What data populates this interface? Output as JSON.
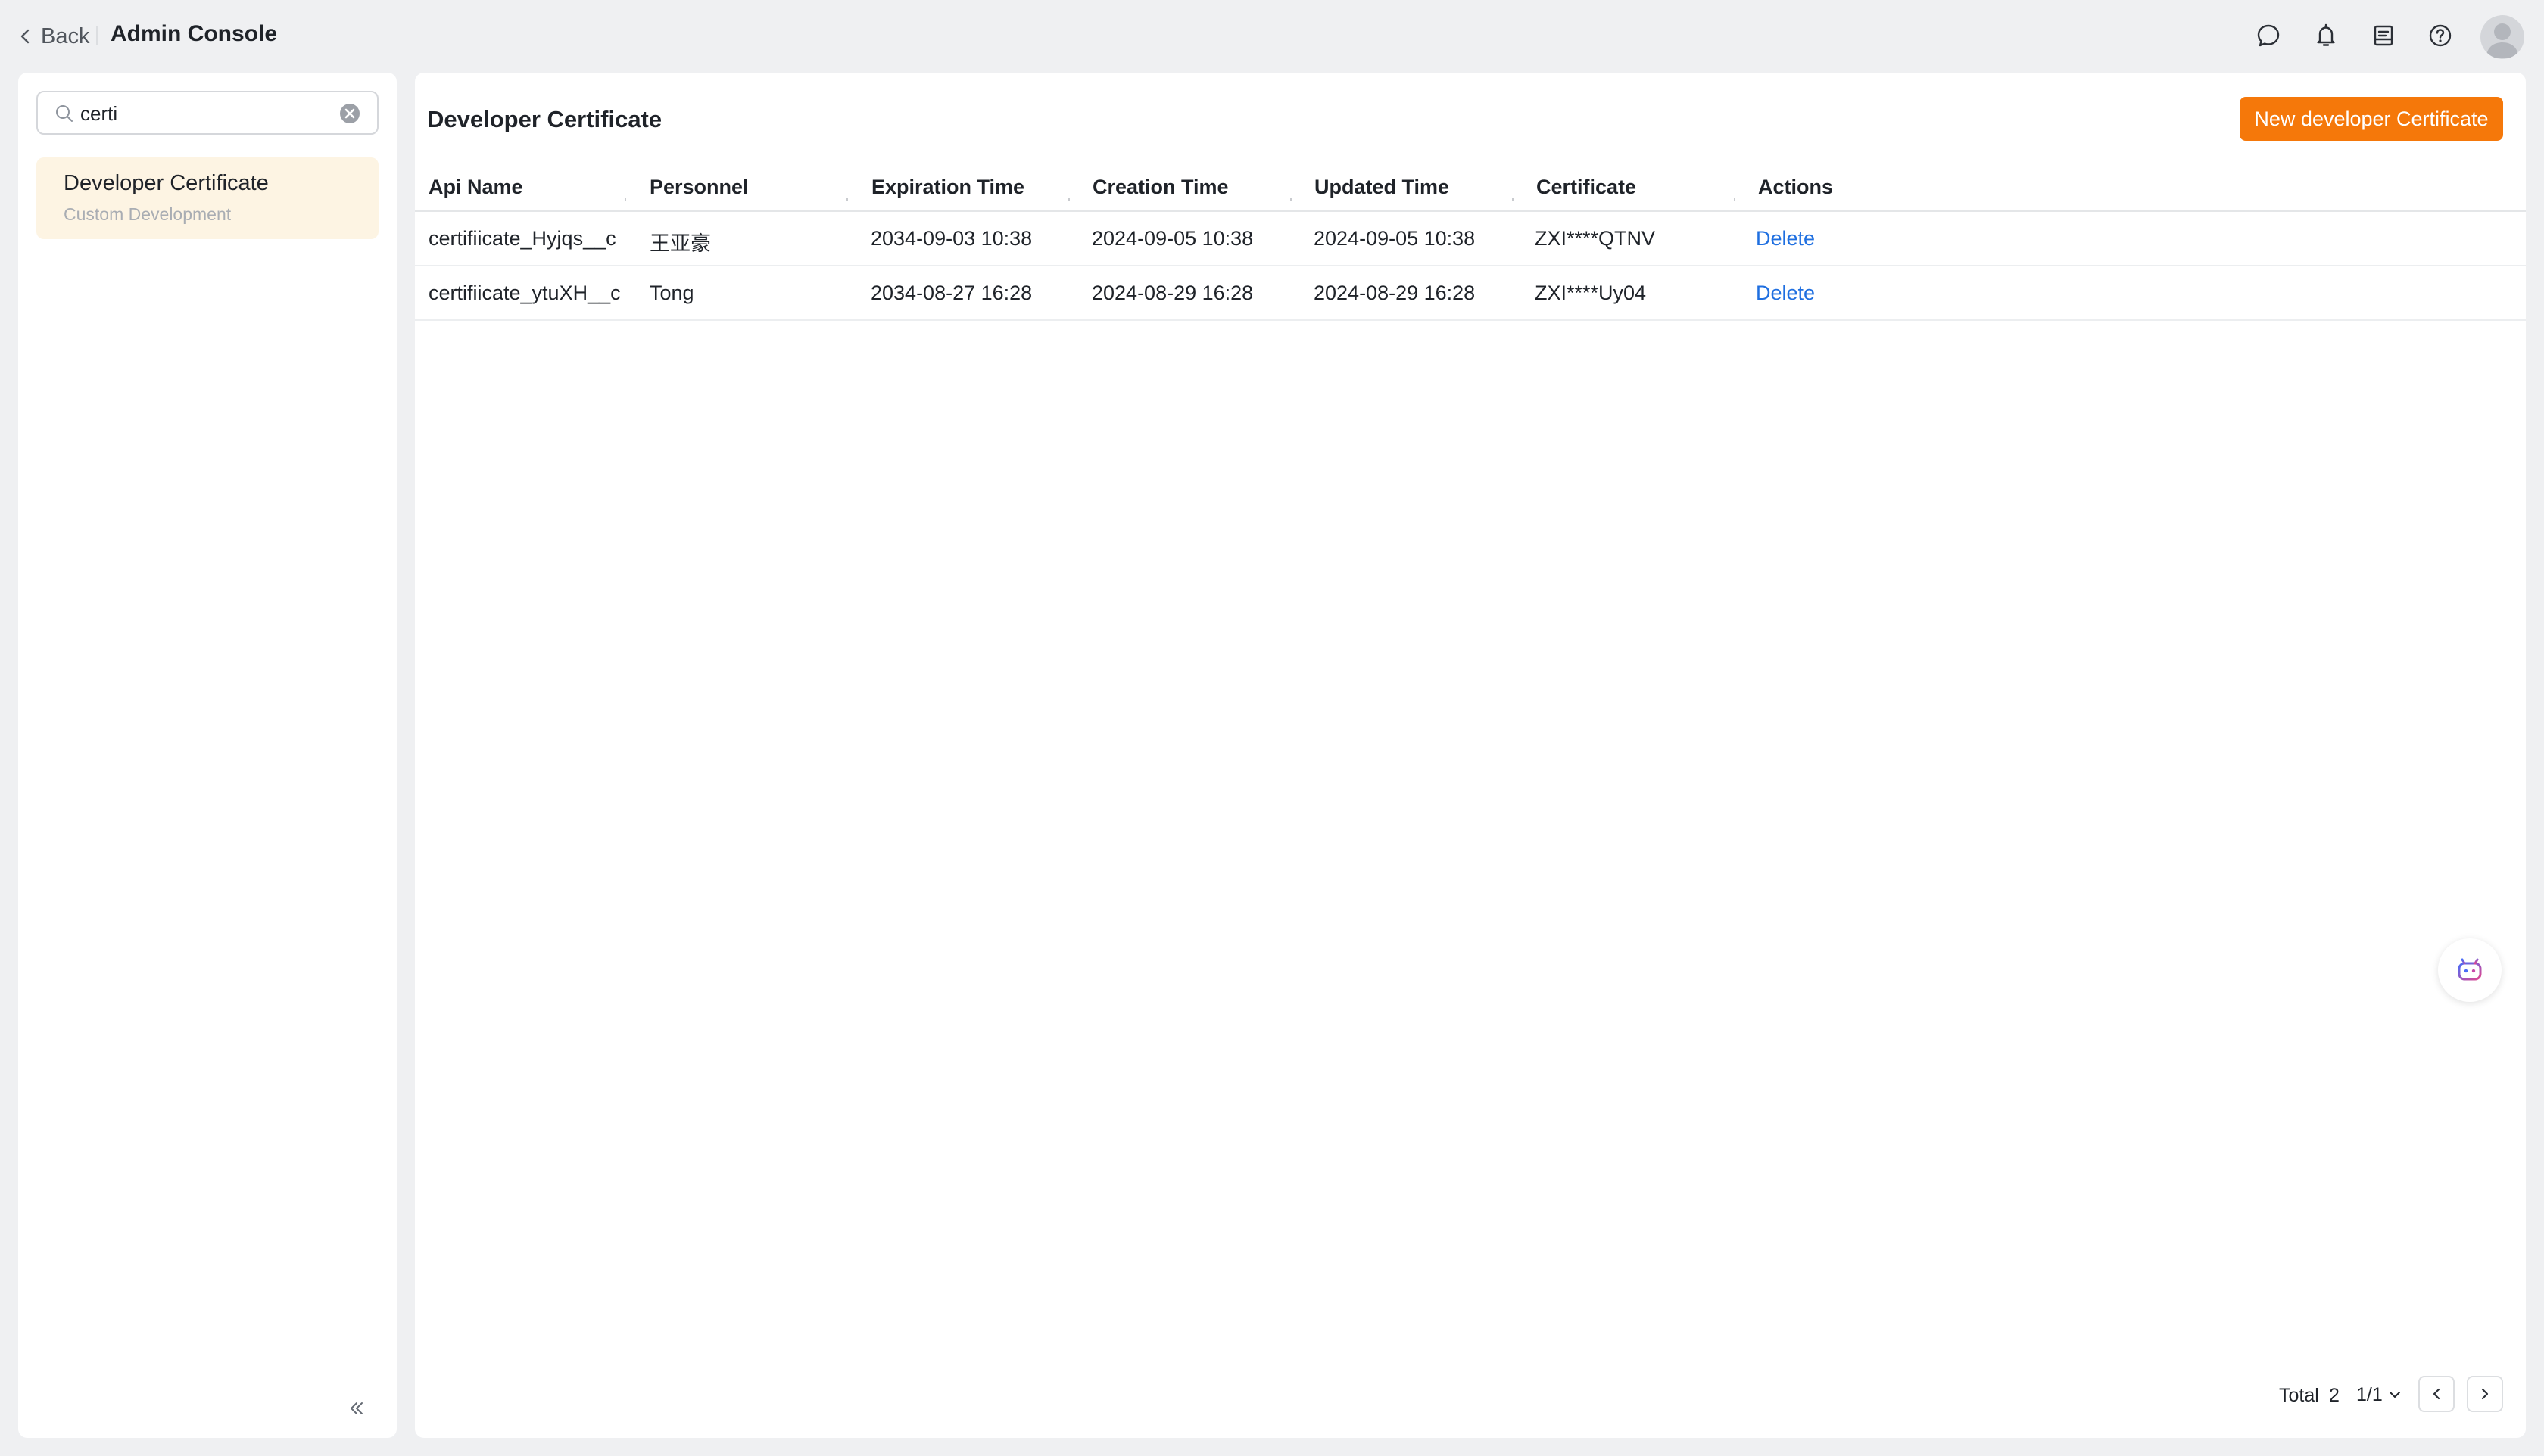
{
  "header": {
    "back_label": "Back",
    "app_title": "Admin Console",
    "icons": [
      "chat-icon",
      "bell-icon",
      "inbox-icon",
      "help-icon",
      "avatar"
    ]
  },
  "sidebar": {
    "search": {
      "value": "certi",
      "placeholder": ""
    },
    "items": [
      {
        "title": "Developer Certificate",
        "subtitle": "Custom Development",
        "selected": true
      }
    ]
  },
  "main": {
    "title": "Developer Certificate",
    "new_button_label": "New developer Certificate",
    "table": {
      "columns": [
        "Api Name",
        "Personnel",
        "Expiration Time",
        "Creation Time",
        "Updated Time",
        "Certificate",
        "Actions"
      ],
      "rows": [
        {
          "api_name": "certifiicate_Hyjqs__c",
          "personnel": "王亚豪",
          "expiration": "2034-09-03 10:38",
          "creation": "2024-09-05 10:38",
          "updated": "2024-09-05 10:38",
          "certificate": "ZXI****QTNV",
          "action": "Delete"
        },
        {
          "api_name": "certifiicate_ytuXH__c",
          "personnel": "Tong",
          "expiration": "2034-08-27 16:28",
          "creation": "2024-08-29 16:28",
          "updated": "2024-08-29 16:28",
          "certificate": "ZXI****Uy04",
          "action": "Delete"
        }
      ]
    },
    "pagination": {
      "total_label": "Total",
      "total_count": "2",
      "page_indicator": "1/1"
    }
  },
  "colors": {
    "accent": "#f5780a",
    "link": "#1f6fe0",
    "selected_bg": "#fdf4e3",
    "page_bg": "#eff0f2"
  }
}
